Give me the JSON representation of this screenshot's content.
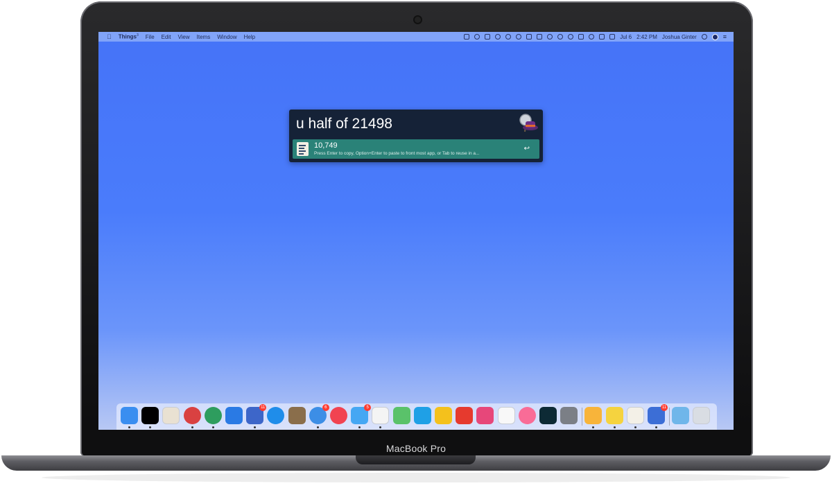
{
  "device": {
    "brand_label": "MacBook Pro"
  },
  "menubar": {
    "apple_icon": "apple-logo-icon",
    "app_name": "Things",
    "app_superscript": "3",
    "menus": [
      "File",
      "Edit",
      "View",
      "Items",
      "Window",
      "Help"
    ],
    "date": "Jul 6",
    "time": "2:42 PM",
    "user": "Joshua Ginter"
  },
  "alfred": {
    "query": "u half of 21498",
    "icon": "alfred-hat-icon",
    "result": {
      "title": "10,749",
      "subtitle": "Press Enter to copy, Option+Enter to paste to front most app, or Tab to reuse in a...",
      "action_glyph": "↩",
      "icon": "calculator-note-icon"
    },
    "colors": {
      "background": "#152237",
      "selected": "#2a8278"
    }
  },
  "dock": {
    "apps": [
      {
        "name": "finder-icon",
        "color": "#3a8ef0",
        "running": true,
        "badge": ""
      },
      {
        "name": "terminal-icon",
        "color": "#000000",
        "running": true,
        "badge": ""
      },
      {
        "name": "mail-stamp-icon",
        "color": "#e9e1d2",
        "running": false,
        "badge": ""
      },
      {
        "name": "airmail-icon",
        "color": "#d94141",
        "running": true,
        "badge": ""
      },
      {
        "name": "bank-icon",
        "color": "#2e9d5e",
        "running": true,
        "badge": ""
      },
      {
        "name": "spark-icon",
        "color": "#2a7ae4",
        "running": false,
        "badge": ""
      },
      {
        "name": "omnifocus-icon",
        "color": "#3d66c9",
        "running": true,
        "badge": "11"
      },
      {
        "name": "safari-icon",
        "color": "#1f8dea",
        "running": false,
        "badge": ""
      },
      {
        "name": "deliveries-icon",
        "color": "#8a6e4b",
        "running": false,
        "badge": ""
      },
      {
        "name": "tweetbot-icon",
        "color": "#3c8ee6",
        "running": true,
        "badge": "6"
      },
      {
        "name": "news-icon",
        "color": "#f14351",
        "running": false,
        "badge": ""
      },
      {
        "name": "messages-icon",
        "color": "#45a7f3",
        "running": true,
        "badge": "5"
      },
      {
        "name": "slack-icon",
        "color": "#f4f4f4",
        "running": true,
        "badge": ""
      },
      {
        "name": "frog-icon",
        "color": "#5ac26a",
        "running": false,
        "badge": ""
      },
      {
        "name": "day-one-icon",
        "color": "#1fa0e6",
        "running": false,
        "badge": ""
      },
      {
        "name": "tes-butterfly-icon",
        "color": "#f4c11c",
        "running": false,
        "badge": ""
      },
      {
        "name": "pocket-cast-icon",
        "color": "#e63a2e",
        "running": false,
        "badge": ""
      },
      {
        "name": "kiwi-icon",
        "color": "#e7477a",
        "running": false,
        "badge": ""
      },
      {
        "name": "ia-writer-icon",
        "color": "#f8f8f8",
        "running": false,
        "badge": ""
      },
      {
        "name": "itunes-icon",
        "color": "#f96c97",
        "running": false,
        "badge": ""
      },
      {
        "name": "lightroom-icon",
        "color": "#0d2a35",
        "running": false,
        "badge": ""
      },
      {
        "name": "system-prefs-icon",
        "color": "#7b7f86",
        "running": false,
        "badge": ""
      },
      {
        "name": "sketch-icon",
        "color": "#f8b43a",
        "running": true,
        "badge": ""
      },
      {
        "name": "cyberduck-icon",
        "color": "#f5d33f",
        "running": true,
        "badge": ""
      },
      {
        "name": "notes-paper-icon",
        "color": "#f3f0e7",
        "running": true,
        "badge": ""
      },
      {
        "name": "things-icon",
        "color": "#3c6ed6",
        "running": true,
        "badge": "11"
      },
      {
        "name": "screenshots-folder-icon",
        "color": "#6fb6ea",
        "running": false,
        "badge": ""
      },
      {
        "name": "trash-icon",
        "color": "#d9dde3",
        "running": false,
        "badge": ""
      }
    ]
  }
}
